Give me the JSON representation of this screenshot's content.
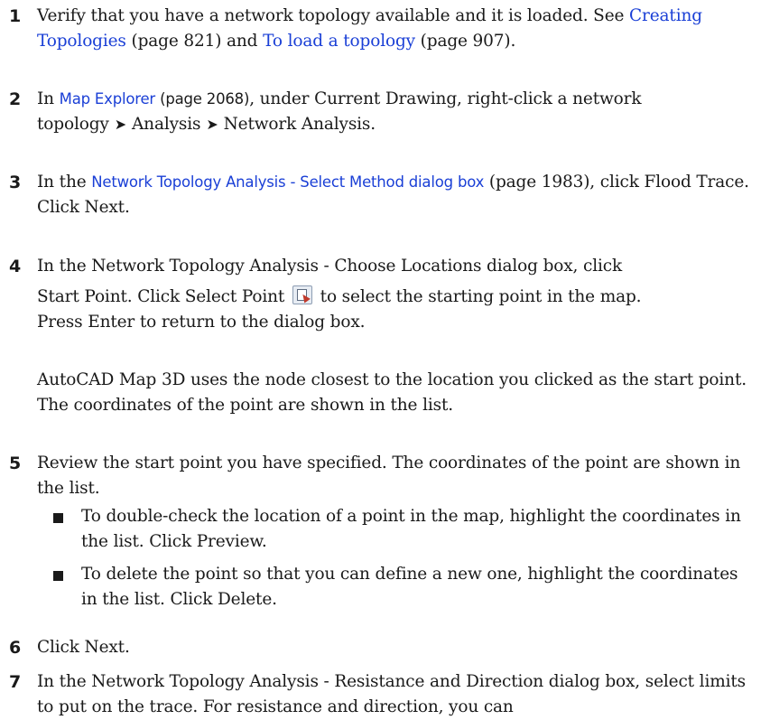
{
  "steps": [
    {
      "num": "1",
      "pre": "Verify that you have a network topology available and it is loaded. See ",
      "link1": "Creating Topologies",
      "mid": " (page 821) and ",
      "link2": "To load a topology",
      "post": " (page 907)."
    },
    {
      "num": "2",
      "pre": "In ",
      "link": "Map Explorer",
      "page": " (page 2068)",
      "post1": ", under Current Drawing, right-click a network topology",
      "arrow": "➤",
      "crumb1": "Analysis",
      "crumb2": "Network Analysis."
    },
    {
      "num": "3",
      "pre": "In the ",
      "link": "Network Topology Analysis - Select Method dialog box",
      "post": " (page 1983), click Flood Trace. Click Next."
    },
    {
      "num": "4",
      "line1": "In the Network Topology Analysis - Choose Locations dialog box, click",
      "line2a": "Start Point. Click Select Point ",
      "line2b": " to select the starting point in the map.",
      "line3": "Press Enter to return to the dialog box.",
      "note": "AutoCAD Map 3D uses the node closest to the location you clicked as the start point. The coordinates of the point are shown in the list."
    },
    {
      "num": "5",
      "text": "Review the start point you have specified. The coordinates of the point are shown in the list.",
      "bullets": [
        "To double-check the location of a point in the map, highlight the coordinates in the list. Click Preview.",
        "To delete the point so that you can define a new one, highlight the coordinates in the list. Click Delete."
      ]
    },
    {
      "num": "6",
      "text": "Click Next."
    },
    {
      "num": "7",
      "text": "In the Network Topology Analysis - Resistance and Direction dialog box, select limits to put on the trace. For resistance and direction, you can"
    }
  ],
  "icons": {
    "select_point": "select-point-icon"
  }
}
